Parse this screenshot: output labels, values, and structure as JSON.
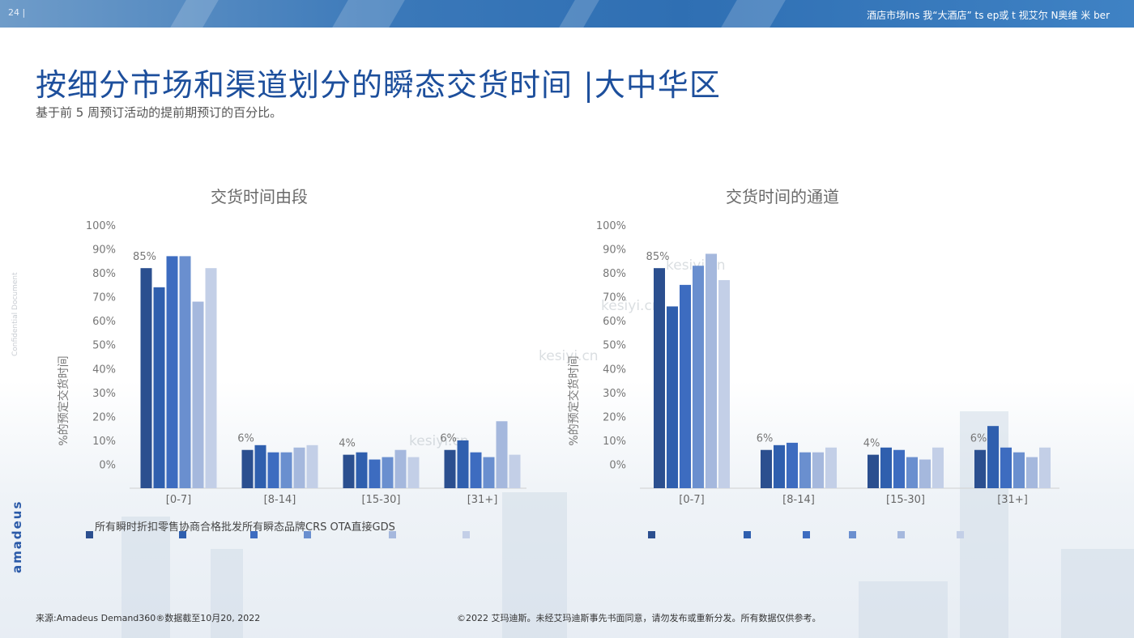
{
  "header": {
    "page_number": "24 |",
    "right_text": "酒店市场Ins 我“大酒店” ts ep或 t 视艾尔 N奥维 米 ber"
  },
  "title": "按细分市场和渠道划分的瞬态交货时间 |大中华区",
  "subtitle": "基于前 5 周预订活动的提前期预订的百分比。",
  "side_text": "Confidential Document",
  "logo": "amadeus",
  "legend_text": "所有瞬时折扣零售协商合格批发所有瞬态品牌CRS OTA直接GDS",
  "footer": {
    "source": "来源:Amadeus Demand360®数据截至10月20, 2022",
    "copyright": "©2022 艾玛迪斯。未经艾玛迪斯事先书面同意，请勿发布或重新分发。所有数据仅供参考。"
  },
  "watermark": "kesiyi.cn",
  "colors": [
    "#2b4f8f",
    "#2f5fae",
    "#3d6cc0",
    "#6a8fcf",
    "#a5b8dd",
    "#c3cfe7"
  ],
  "chart_data": [
    {
      "type": "bar",
      "title": "交货时间由段",
      "ylabel": "%的预定交货时间",
      "categories": [
        "[0-7]",
        "[8-14]",
        "[15-30]",
        "[31+]"
      ],
      "series": [
        {
          "values": [
            82,
            6,
            4,
            6
          ]
        },
        {
          "values": [
            74,
            8,
            5,
            10
          ]
        },
        {
          "values": [
            87,
            5,
            2,
            5
          ]
        },
        {
          "values": [
            87,
            5,
            3,
            3
          ]
        },
        {
          "values": [
            68,
            7,
            6,
            18
          ]
        },
        {
          "values": [
            82,
            8,
            3,
            4
          ]
        }
      ],
      "data_labels": [
        "85%",
        "6%",
        "4%",
        "6%"
      ],
      "y_ticks": [
        "0%",
        "10%",
        "20%",
        "30%",
        "40%",
        "50%",
        "60%",
        "70%",
        "80%",
        "90%",
        "100%"
      ],
      "ylim": [
        -10,
        100
      ]
    },
    {
      "type": "bar",
      "title": "交货时间的通道",
      "ylabel": "%的预定交货时间",
      "categories": [
        "[0-7]",
        "[8-14]",
        "[15-30]",
        "[31+]"
      ],
      "series": [
        {
          "values": [
            82,
            6,
            4,
            6
          ]
        },
        {
          "values": [
            66,
            8,
            7,
            16
          ]
        },
        {
          "values": [
            75,
            9,
            6,
            7
          ]
        },
        {
          "values": [
            83,
            5,
            3,
            5
          ]
        },
        {
          "values": [
            88,
            5,
            2,
            3
          ]
        },
        {
          "values": [
            77,
            7,
            7,
            7
          ]
        }
      ],
      "data_labels": [
        "85%",
        "6%",
        "4%",
        "6%"
      ],
      "y_ticks": [
        "0%",
        "10%",
        "20%",
        "30%",
        "40%",
        "50%",
        "60%",
        "70%",
        "80%",
        "90%",
        "100%"
      ],
      "ylim": [
        -10,
        100
      ]
    }
  ]
}
